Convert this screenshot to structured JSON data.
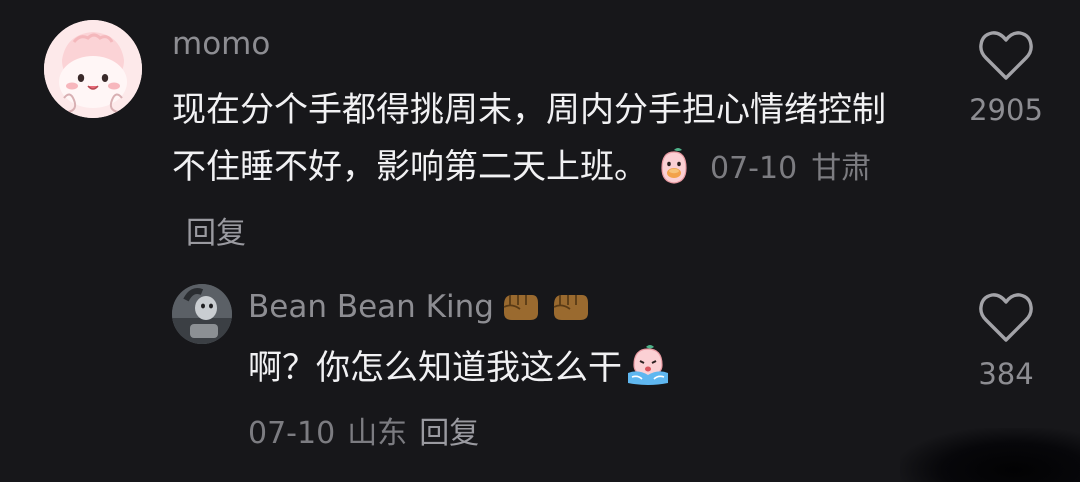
{
  "comments": [
    {
      "username": "momo",
      "text": "现在分个手都得挑周末，周内分手担心情绪控制不住睡不好，影响第二天上班。",
      "inline_emoji": "peach-eating-emoji",
      "date": "07-10",
      "location": "甘肃",
      "reply_label": "回复",
      "likes": "2905",
      "avatar": "pink-cartoon-avatar",
      "reply": {
        "username": "Bean Bean King",
        "username_emojis": [
          "fist-emoji",
          "fist-emoji"
        ],
        "text": "啊？你怎么知道我这么干",
        "inline_emoji": "crying-peach-emoji",
        "date": "07-10",
        "location": "山东",
        "reply_label": "回复",
        "likes": "384",
        "avatar": "photo-avatar"
      }
    }
  ],
  "icons": {
    "like": "heart-outline-icon"
  },
  "colors": {
    "background": "#17171a",
    "text_primary": "#f1f1f3",
    "text_secondary": "#8d8d92",
    "meta": "#7c7c81"
  }
}
